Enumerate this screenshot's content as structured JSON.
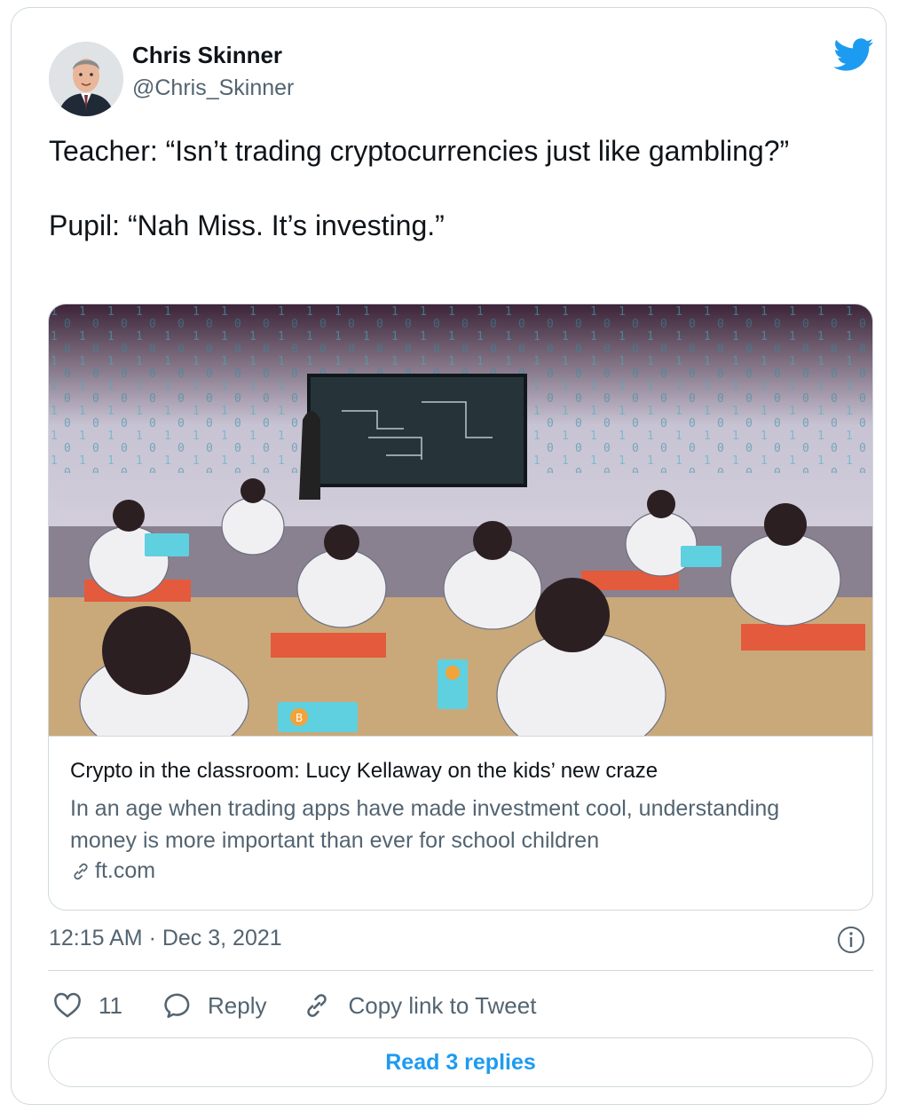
{
  "author": {
    "name": "Chris Skinner",
    "handle": "@Chris_Skinner"
  },
  "tweet": {
    "text": "Teacher: “Isn’t trading cryptocurrencies just like gambling?”\n\nPupil: “Nah Miss. It’s investing.”"
  },
  "link_card": {
    "title": "Crypto in the classroom: Lucy Kellaway on the kids’ new craze",
    "description": "In an age when trading apps have made investment cool, understanding money is more important than ever for school children",
    "domain": "ft.com"
  },
  "timestamp": "12:15 AM · Dec 3, 2021",
  "actions": {
    "like_count": "11",
    "reply_label": "Reply",
    "copy_link_label": "Copy link to Tweet"
  },
  "read_replies_label": "Read 3 replies",
  "colors": {
    "brand_blue": "#1d9bf0",
    "text_primary": "#0f1419",
    "text_secondary": "#536471",
    "border": "#cfd9de"
  },
  "icons": [
    "twitter-bird-icon",
    "link-icon",
    "info-icon",
    "heart-icon",
    "reply-icon",
    "copy-link-icon"
  ]
}
